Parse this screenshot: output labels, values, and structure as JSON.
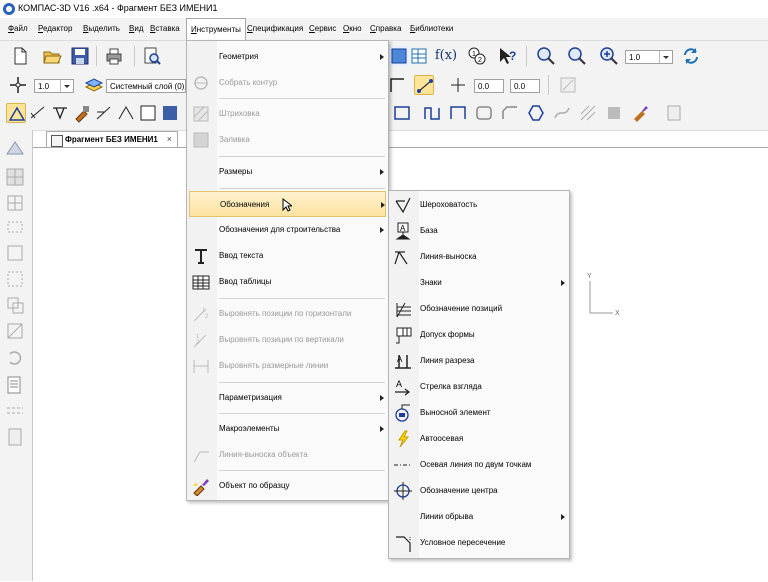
{
  "window": {
    "title": "КОМПАС-3D V16 .x64 - Фрагмент БЕЗ ИМЕНИ1"
  },
  "menubar": {
    "items": [
      {
        "label": "Файл",
        "ul": "Ф",
        "rest": "айл"
      },
      {
        "label": "Редактор",
        "ul": "Р",
        "rest": "едактор"
      },
      {
        "label": "Выделить",
        "ul": "В",
        "rest": "ыделить"
      },
      {
        "label": "Вид",
        "ul": "В",
        "rest": "ид"
      },
      {
        "label": "Вставка",
        "ul": "В",
        "rest": "ставка"
      },
      {
        "label": "Инструменты",
        "ul": "И",
        "rest": "нструменты"
      },
      {
        "label": "Спецификация",
        "ul": "С",
        "rest": "пецификация"
      },
      {
        "label": "Сервис",
        "ul": "С",
        "rest": "ервис"
      },
      {
        "label": "Окно",
        "ul": "О",
        "rest": "кно"
      },
      {
        "label": "Справка",
        "ul": "С",
        "rest": "правка"
      },
      {
        "label": "Библиотеки",
        "ul": "Б",
        "rest": "иблиотеки"
      }
    ]
  },
  "toolbar": {
    "scale_left": "1.0",
    "layer": "Системный слой (0)",
    "zoom": "1.0",
    "coord_x": "0.0",
    "coord_y": "0.0",
    "fx_label": "f(x)"
  },
  "document": {
    "tab_label": "Фрагмент БЕЗ ИМЕНИ1",
    "close_glyph": "×",
    "axis_x": "X",
    "axis_y": "Y"
  },
  "tools_menu": {
    "items": [
      {
        "label": "Геометрия",
        "icon": "none",
        "disabled": false,
        "submenu": true
      },
      {
        "label": "Собрать контур",
        "icon": "contour-icon",
        "disabled": true,
        "submenu": false
      },
      {
        "label": "Штриховка",
        "icon": "hatch-icon",
        "disabled": true,
        "submenu": false
      },
      {
        "label": "Заливка",
        "icon": "fill-icon",
        "disabled": true,
        "submenu": false
      },
      {
        "label": "Размеры",
        "icon": "none",
        "disabled": false,
        "submenu": true
      },
      {
        "label": "Обозначения",
        "icon": "none",
        "disabled": false,
        "submenu": true,
        "highlighted": true
      },
      {
        "label": "Обозначения для строительства",
        "icon": "none",
        "disabled": false,
        "submenu": true
      },
      {
        "label": "Ввод текста",
        "icon": "text-icon",
        "disabled": false,
        "submenu": false
      },
      {
        "label": "Ввод таблицы",
        "icon": "table-icon",
        "disabled": false,
        "submenu": false
      },
      {
        "label": "Выровнять позиции по горизонтали",
        "icon": "align-h-icon",
        "disabled": true,
        "submenu": false
      },
      {
        "label": "Выровнять позиции по вертикали",
        "icon": "align-v-icon",
        "disabled": true,
        "submenu": false
      },
      {
        "label": "Выровнять размерные линии",
        "icon": "align-dim-icon",
        "disabled": true,
        "submenu": false
      },
      {
        "label": "Параметризация",
        "icon": "none",
        "disabled": false,
        "submenu": true
      },
      {
        "label": "Макроэлементы",
        "icon": "none",
        "disabled": false,
        "submenu": true
      },
      {
        "label": "Линия-выноска объекта",
        "icon": "leader-object-icon",
        "disabled": true,
        "submenu": false
      },
      {
        "label": "Объект по образцу",
        "icon": "brush-icon",
        "disabled": false,
        "submenu": false
      }
    ]
  },
  "designations_menu": {
    "items": [
      {
        "label": "Шероховатость",
        "icon": "roughness-icon",
        "submenu": false
      },
      {
        "label": "База",
        "icon": "base-icon",
        "submenu": false
      },
      {
        "label": "Линия-выноска",
        "icon": "leader-icon",
        "submenu": false
      },
      {
        "label": "Знаки",
        "icon": "none",
        "submenu": true
      },
      {
        "label": "Обозначение позиций",
        "icon": "position-icon",
        "submenu": false
      },
      {
        "label": "Допуск формы",
        "icon": "tolerance-icon",
        "submenu": false
      },
      {
        "label": "Линия разреза",
        "icon": "cut-line-icon",
        "submenu": false
      },
      {
        "label": "Стрелка взгляда",
        "icon": "view-arrow-icon",
        "submenu": false
      },
      {
        "label": "Выносной элемент",
        "icon": "detail-element-icon",
        "submenu": false
      },
      {
        "label": "Автоосевая",
        "icon": "auto-axis-icon",
        "submenu": false
      },
      {
        "label": "Осевая линия по двум точкам",
        "icon": "axis-line-icon",
        "submenu": false
      },
      {
        "label": "Обозначение центра",
        "icon": "center-mark-icon",
        "submenu": false
      },
      {
        "label": "Линии обрыва",
        "icon": "none",
        "submenu": true
      },
      {
        "label": "Условное пересечение",
        "icon": "intersection-icon",
        "submenu": false
      }
    ]
  }
}
